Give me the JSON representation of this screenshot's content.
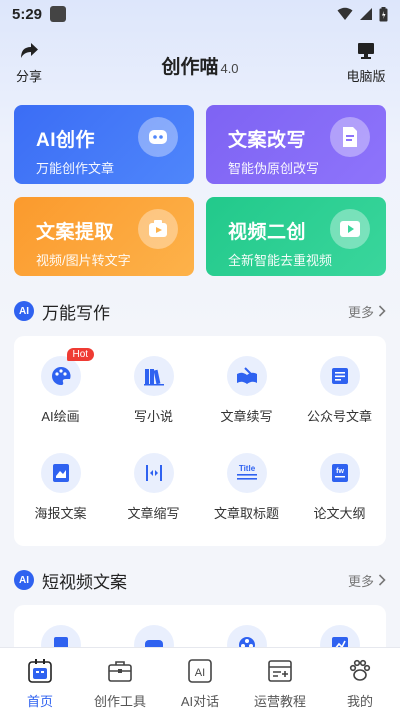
{
  "status_bar": {
    "time": "5:29"
  },
  "header": {
    "share_label": "分享",
    "title": "创作喵",
    "version": "4.0",
    "pc_label": "电脑版"
  },
  "feature_cards": [
    {
      "title": "AI创作",
      "subtitle": "万能创作文章",
      "icon": "robot-icon",
      "color": "#3b6df5"
    },
    {
      "title": "文案改写",
      "subtitle": "智能伪原创改写",
      "icon": "edit-doc-icon",
      "color": "#7e63f3"
    },
    {
      "title": "文案提取",
      "subtitle": "视频/图片转文字",
      "icon": "extract-icon",
      "color": "#fb9a2d"
    },
    {
      "title": "视频二创",
      "subtitle": "全新智能去重视频",
      "icon": "video-icon",
      "color": "#22c98b"
    }
  ],
  "sections": {
    "writing": {
      "badge": "AI",
      "title": "万能写作",
      "more": "更多",
      "tools": [
        {
          "label": "AI绘画",
          "icon": "palette-icon",
          "badge": "Hot"
        },
        {
          "label": "写小说",
          "icon": "books-icon"
        },
        {
          "label": "文章续写",
          "icon": "open-book-icon"
        },
        {
          "label": "公众号文章",
          "icon": "article-icon"
        },
        {
          "label": "海报文案",
          "icon": "poster-icon"
        },
        {
          "label": "文章缩写",
          "icon": "compress-icon"
        },
        {
          "label": "文章取标题",
          "icon": "title-icon"
        },
        {
          "label": "论文大纲",
          "icon": "paper-icon"
        }
      ]
    },
    "short_video": {
      "badge": "AI",
      "title": "短视频文案",
      "more": "更多"
    }
  },
  "tabbar": [
    {
      "label": "首页",
      "icon": "home-icon",
      "active": true
    },
    {
      "label": "创作工具",
      "icon": "toolbox-icon",
      "active": false
    },
    {
      "label": "AI对话",
      "icon": "ai-chat-icon",
      "active": false
    },
    {
      "label": "运营教程",
      "icon": "tutorial-icon",
      "active": false
    },
    {
      "label": "我的",
      "icon": "paw-icon",
      "active": false
    }
  ],
  "colors": {
    "accent": "#2f62f0",
    "hot": "#ef3b33"
  }
}
